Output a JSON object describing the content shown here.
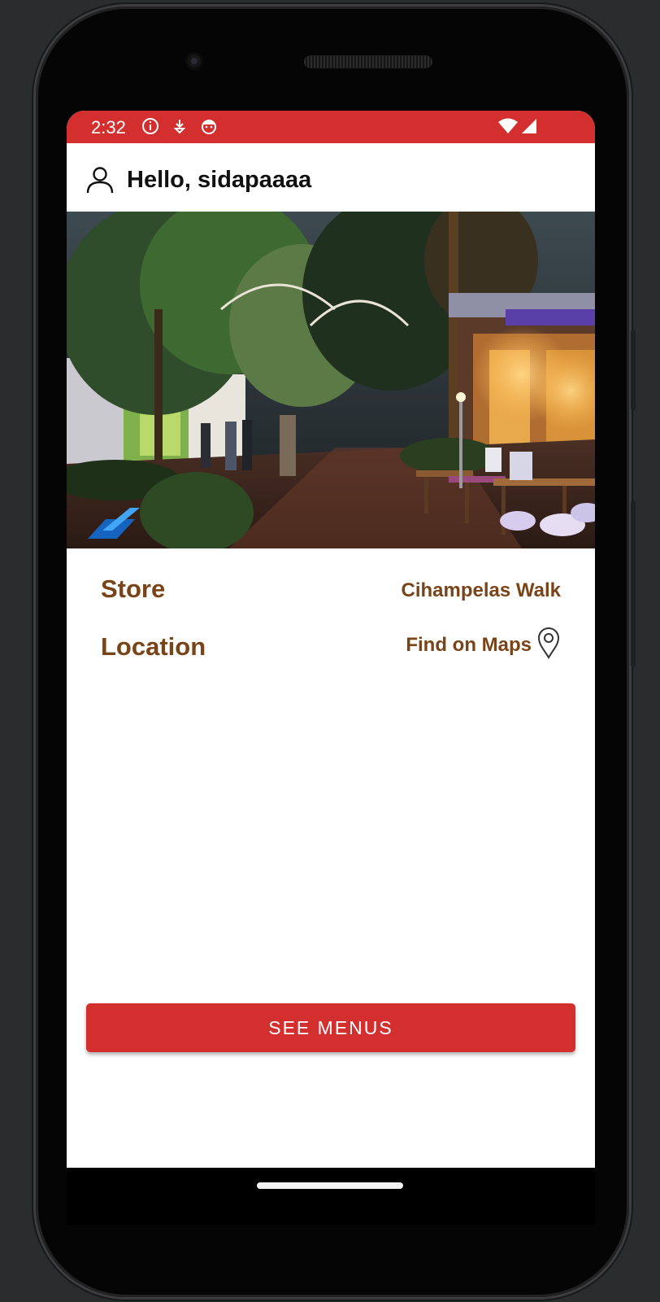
{
  "status_bar": {
    "time": "2:32",
    "icons": [
      "info-icon",
      "download-icon",
      "face-icon",
      "wifi-icon",
      "signal-icon"
    ]
  },
  "app_bar": {
    "greeting": "Hello, sidapaaaa",
    "icon": "user-icon"
  },
  "hero_image": {
    "description_icon": "store-photo",
    "logo": "brand-logo-icon"
  },
  "store_info": {
    "store_label": "Store",
    "store_value": "Cihampelas Walk",
    "location_label": "Location",
    "location_value": "Find on Maps",
    "location_icon": "map-pin-icon"
  },
  "actions": {
    "see_menus": "SEE MENUS"
  },
  "colors": {
    "primary": "#d32f2f",
    "accent_text": "#7a4419"
  }
}
